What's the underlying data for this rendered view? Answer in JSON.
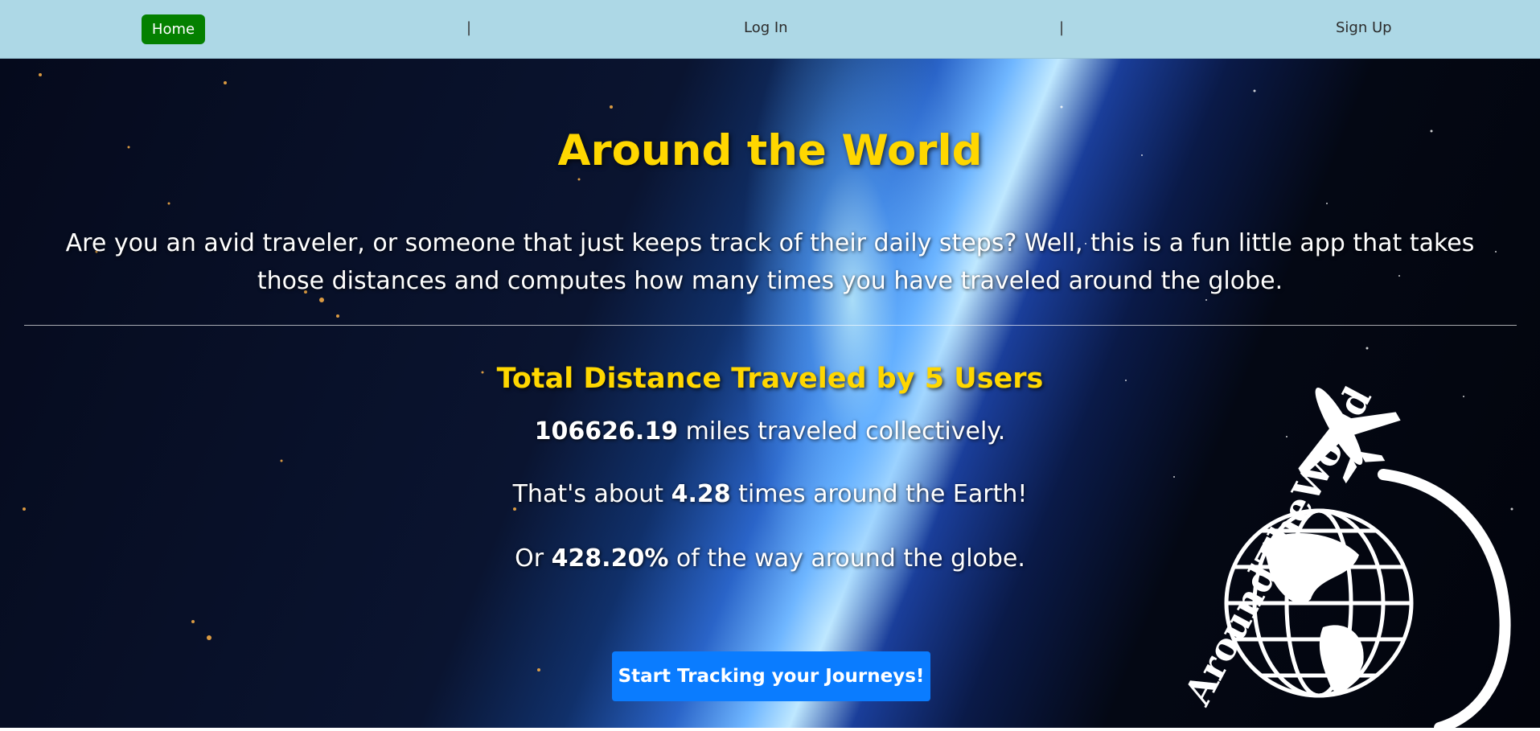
{
  "nav": {
    "home_label": "Home",
    "separator": "|",
    "login_label": "Log In",
    "signup_label": "Sign Up"
  },
  "hero": {
    "title": "Around the World",
    "intro": "Are you an avid traveler, or someone that just keeps track of their daily steps? Well, this is a fun little app that takes those distances and computes how many times you have traveled around the globe.",
    "subtitle": "Total Distance Traveled by 5 Users",
    "stats": {
      "miles_value": "106626.19",
      "miles_suffix": " miles traveled collectively.",
      "times_prefix": "That's about ",
      "times_value": "4.28",
      "times_suffix": " times around the Earth!",
      "percent_prefix": "Or ",
      "percent_value": "428.20%",
      "percent_suffix": " of the way around the globe."
    },
    "cta_label": "Start Tracking your Journeys!"
  },
  "logo": {
    "text": "AroundTheWorld",
    "icon": "airplane-globe-logo"
  },
  "colors": {
    "navbar_bg": "#add8e6",
    "home_button_bg": "#048000",
    "title_color": "#ffd700",
    "cta_bg": "#0a7cff"
  }
}
